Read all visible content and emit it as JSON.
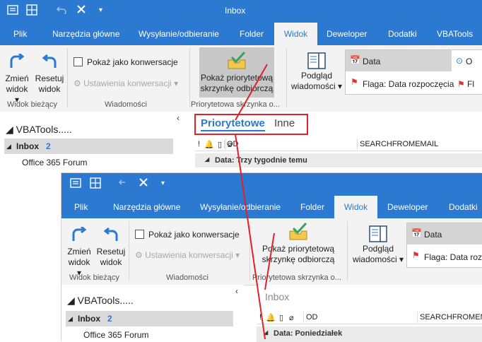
{
  "app": {
    "title": "Inbox",
    "tabs": [
      "Plik",
      "Narzędzia główne",
      "Wysyłanie/odbieranie",
      "Folder",
      "Widok",
      "Deweloper",
      "Dodatki",
      "VBATools"
    ],
    "active_tab": "Widok"
  },
  "ribbon": {
    "change_view": "Zmień widok",
    "change_view_lines": [
      "Zmień",
      "widok"
    ],
    "reset_view_lines": [
      "Resetuj",
      "widok"
    ],
    "group_current_view": "Widok bieżący",
    "show_conversations": "Pokaż jako konwersacje",
    "conversation_settings": "Ustawienia konwersacji",
    "group_messages": "Wiadomości",
    "focused_inbox_lines": [
      "Pokaż priorytetową",
      "skrzynkę odbiorczą"
    ],
    "group_focused_w1": "Priorytetowa skrzynka o...",
    "group_focused_w2": "Priorytetowa skrzynka o...",
    "reading_pane_lines": [
      "Podgląd",
      "wiadomości"
    ],
    "gallery_date": "Data",
    "gallery_flag": "Flaga: Data rozpoczęcia",
    "gallery_flag_cut": "Flaga: Data rozp",
    "gallery_o": "O",
    "gallery_fl": "Fl"
  },
  "nav": {
    "account": "VBATools.....",
    "inbox_label": "Inbox",
    "inbox_count": "2",
    "folder_office": "Office 365 Forum",
    "collapse_glyph": "‹"
  },
  "window1": {
    "tab_focused": "Priorytetowe",
    "tab_other": "Inne",
    "col_from": "OD",
    "col_search": "SEARCHFROMEMAIL",
    "group_header": "Data: Trzy tygodnie temu"
  },
  "window2": {
    "folder_title": "Inbox",
    "col_from": "OD",
    "col_search": "SEARCHFROMEMAIL",
    "group_header": "Data: Poniedziałek"
  },
  "colors": {
    "accent": "#2b79d0",
    "annotation": "#e0202a",
    "ribbon_bg": "#f3f3f3"
  }
}
